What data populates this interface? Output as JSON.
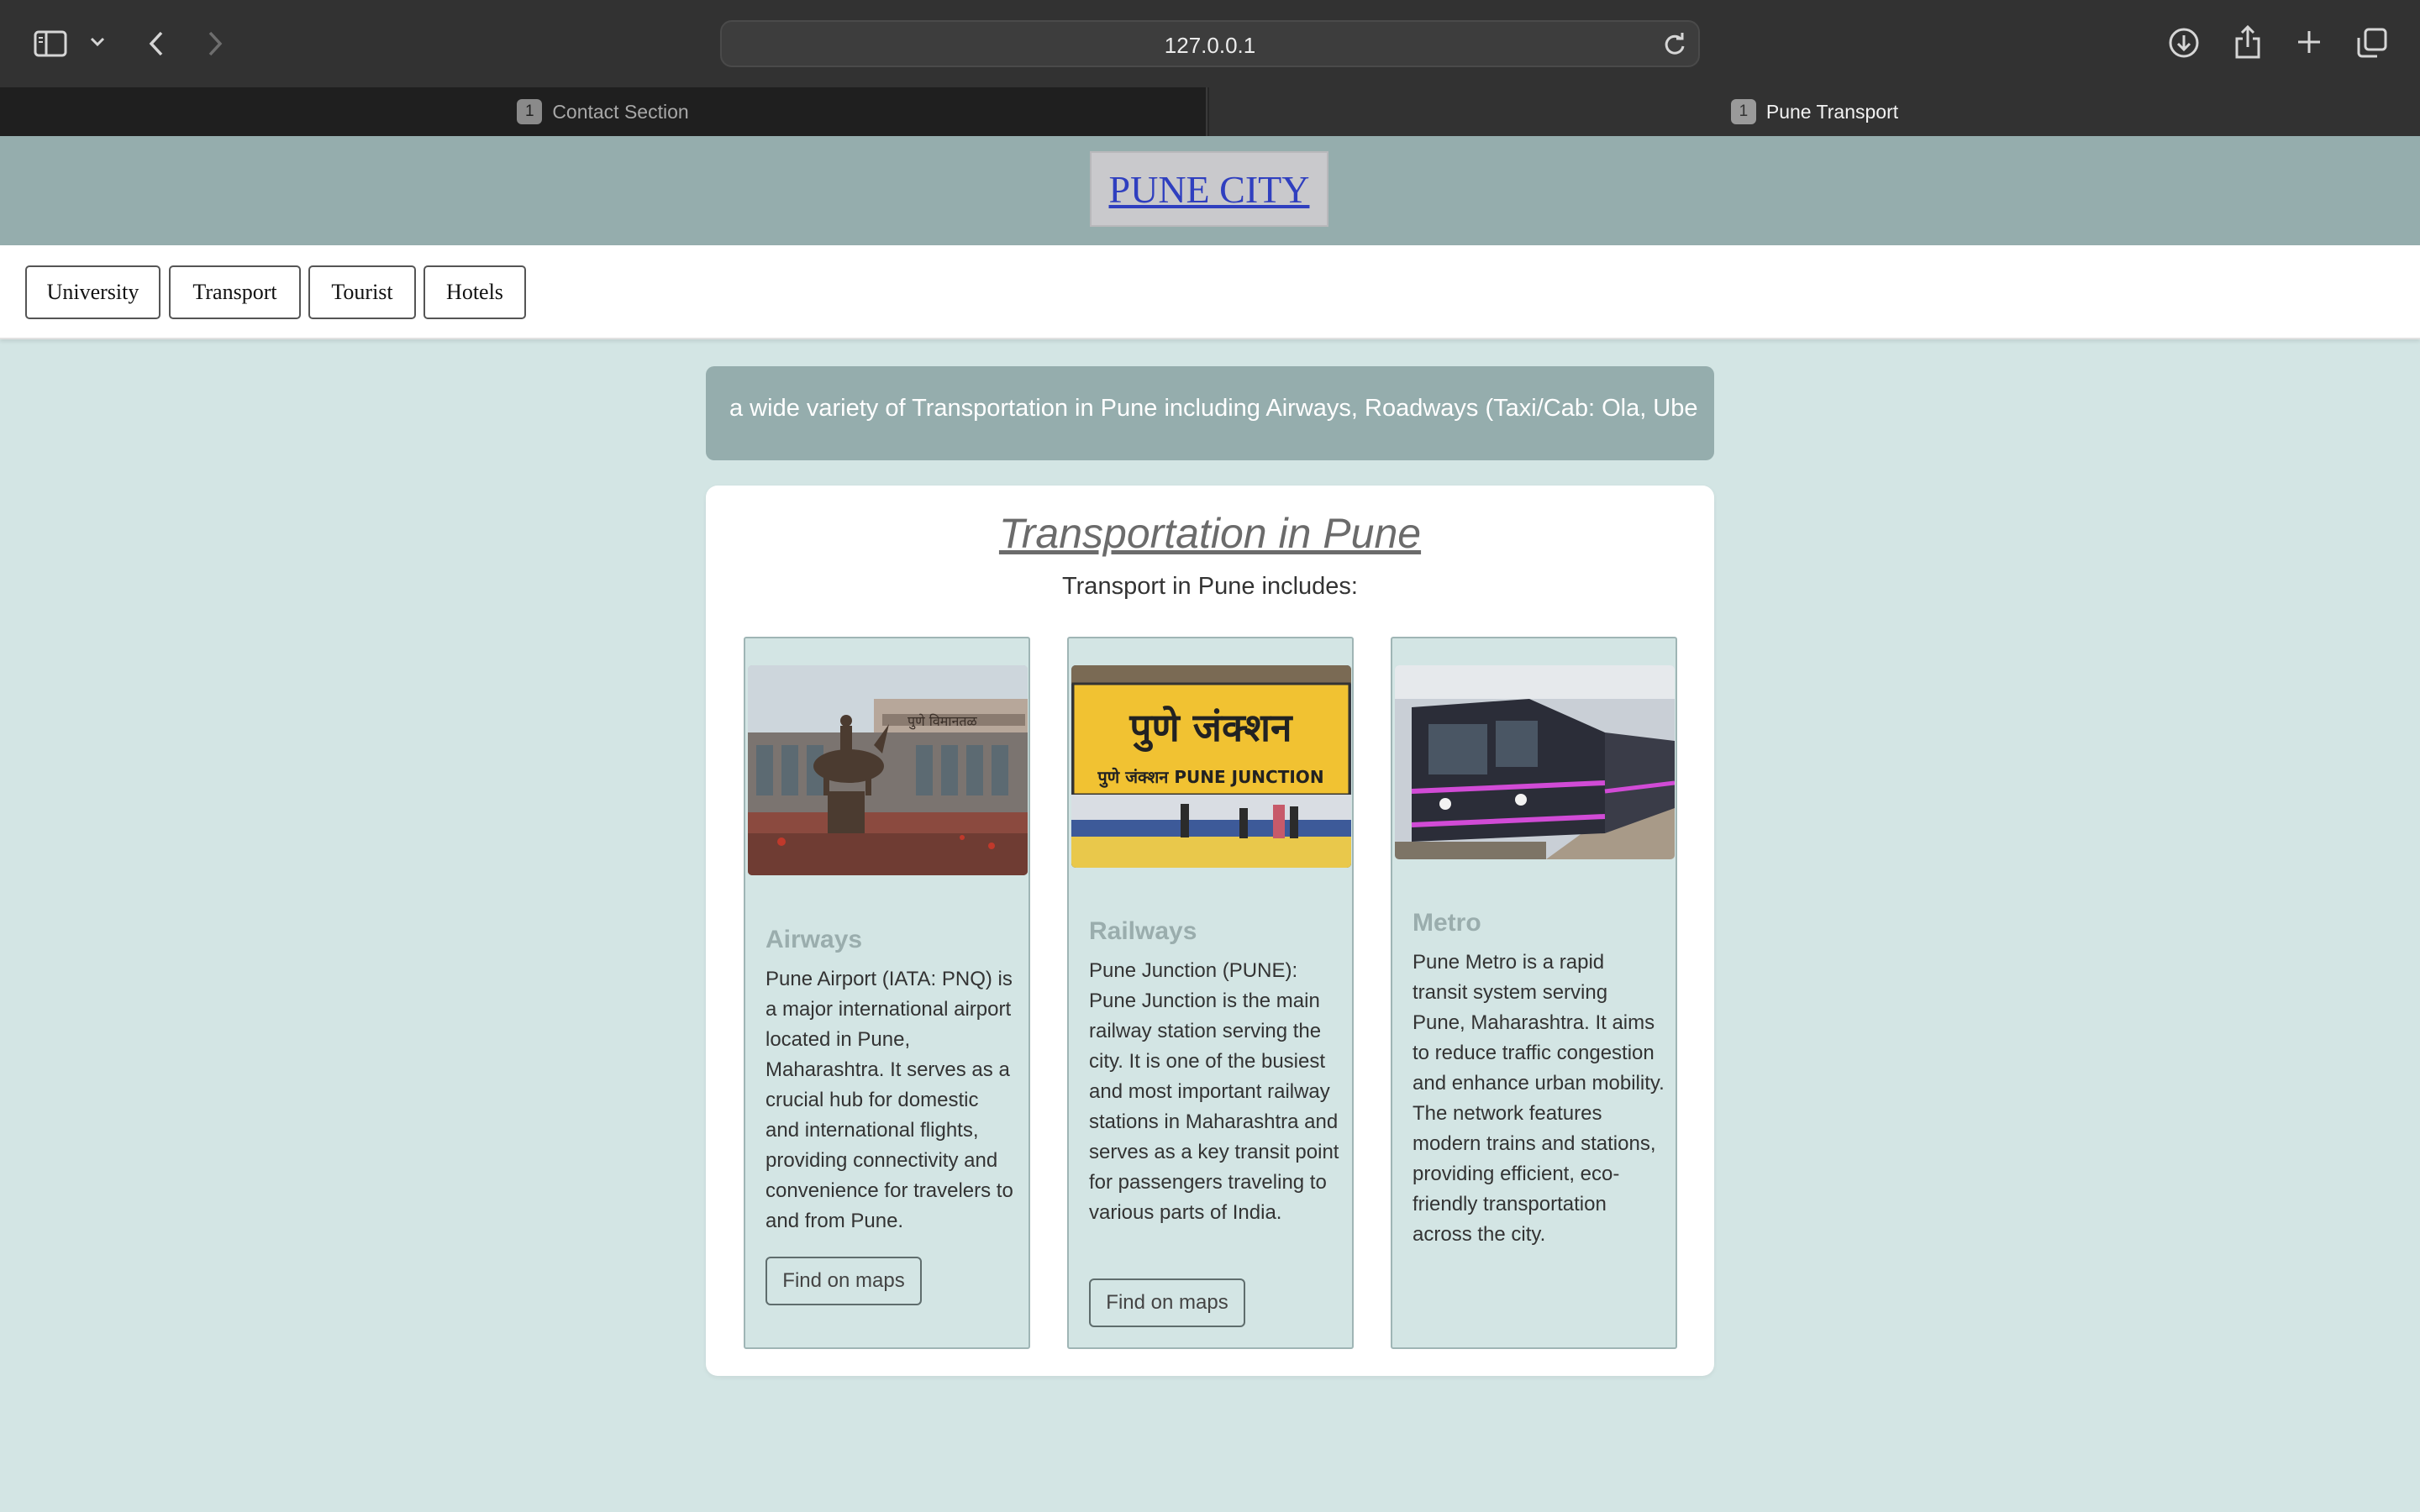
{
  "browser": {
    "url": "127.0.0.1",
    "tabs": [
      {
        "badge": "1",
        "label": "Contact Section"
      },
      {
        "badge": "1",
        "label": "Pune Transport"
      }
    ]
  },
  "header": {
    "brand": "PUNE CITY"
  },
  "nav": {
    "items": [
      "University",
      "Transport",
      "Tourist",
      "Hotels"
    ]
  },
  "marquee": {
    "text": "a wide variety of Transportation in Pune including Airways, Roadways (Taxi/Cab: Ola, Ube"
  },
  "main": {
    "title": "Transportation in Pune",
    "subtitle": "Transport in Pune includes:",
    "cards": [
      {
        "title": "Airways",
        "text": "Pune Airport (IATA: PNQ) is a major international airport located in Pune, Maharashtra. It serves as a crucial hub for domestic and international flights, providing connectivity and convenience for travelers to and from Pune.",
        "button": "Find on maps",
        "image_text": "पुणे विमानतळ"
      },
      {
        "title": "Railways",
        "text": "Pune Junction (PUNE): Pune Junction is the main railway station serving the city. It is one of the busiest and most important railway stations in Maharashtra and serves as a key transit point for passengers traveling to various parts of India.",
        "button": "Find on maps",
        "image_text_large": "पुणे जंक्शन",
        "image_text_small": "पुणे जंक्शन  PUNE JUNCTION"
      },
      {
        "title": "Metro",
        "text": "Pune Metro is a rapid transit system serving Pune, Maharashtra. It aims to reduce traffic congestion and enhance urban mobility. The network features modern trains and stations, providing efficient, eco-friendly transportation across the city."
      }
    ]
  },
  "colors": {
    "page_bg": "#d3e5e4",
    "header_bg": "#95adad",
    "brand_link": "#2f3fbf",
    "card_title": "#9aadad"
  }
}
